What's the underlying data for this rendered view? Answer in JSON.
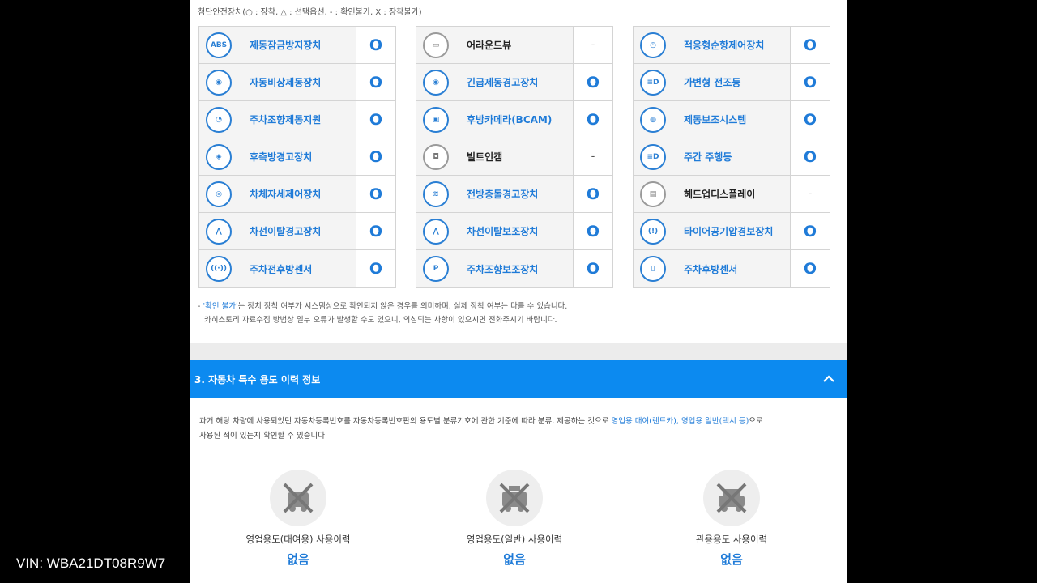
{
  "legend": "첨단안전장치(○ : 장착, △ : 선택옵션, - : 확인불가, X : 장착불가)",
  "columns": [
    [
      {
        "icon": "abs-icon",
        "icon_text": "ABS",
        "label": "제동잠금방지장치",
        "value": "O",
        "on": true
      },
      {
        "icon": "emergency-brake-icon",
        "icon_text": "◉",
        "label": "자동비상제동장치",
        "value": "O",
        "on": true
      },
      {
        "icon": "parking-steer-icon",
        "icon_text": "◔",
        "label": "주차조향제동지원",
        "value": "O",
        "on": true
      },
      {
        "icon": "rear-side-warning-icon",
        "icon_text": "◈",
        "label": "후측방경고장치",
        "value": "O",
        "on": true
      },
      {
        "icon": "stability-control-icon",
        "icon_text": "◎",
        "label": "차체자세제어장치",
        "value": "O",
        "on": true
      },
      {
        "icon": "lane-departure-icon",
        "icon_text": "⋀",
        "label": "차선이탈경고장치",
        "value": "O",
        "on": true
      },
      {
        "icon": "parking-sensor-icon",
        "icon_text": "((·))",
        "label": "주차전후방센서",
        "value": "O",
        "on": true
      }
    ],
    [
      {
        "icon": "around-view-icon",
        "icon_text": "▭",
        "label": "어라운드뷰",
        "value": "-",
        "on": false
      },
      {
        "icon": "emergency-warning-icon",
        "icon_text": "◉",
        "label": "긴급제동경고장치",
        "value": "O",
        "on": true
      },
      {
        "icon": "rear-camera-icon",
        "icon_text": "▣",
        "label": "후방카메라(BCAM)",
        "value": "O",
        "on": true
      },
      {
        "icon": "builtin-cam-icon",
        "icon_text": "◘",
        "label": "빌트인캠",
        "value": "-",
        "on": false
      },
      {
        "icon": "forward-collision-icon",
        "icon_text": "≋",
        "label": "전방충돌경고장치",
        "value": "O",
        "on": true
      },
      {
        "icon": "lane-keep-icon",
        "icon_text": "⋀",
        "label": "차선이탈보조장치",
        "value": "O",
        "on": true
      },
      {
        "icon": "parking-assist-icon",
        "icon_text": "P",
        "label": "주차조향보조장치",
        "value": "O",
        "on": true
      }
    ],
    [
      {
        "icon": "adaptive-cruise-icon",
        "icon_text": "◷",
        "label": "적응형순항제어장치",
        "value": "O",
        "on": true
      },
      {
        "icon": "adaptive-headlight-icon",
        "icon_text": "≡D",
        "label": "가변형 전조등",
        "value": "O",
        "on": true
      },
      {
        "icon": "brake-assist-icon",
        "icon_text": "◍",
        "label": "제동보조시스템",
        "value": "O",
        "on": true
      },
      {
        "icon": "daytime-light-icon",
        "icon_text": "≡D",
        "label": "주간 주행등",
        "value": "O",
        "on": true
      },
      {
        "icon": "hud-icon",
        "icon_text": "▤",
        "label": "헤드업디스플레이",
        "value": "-",
        "on": false
      },
      {
        "icon": "tire-pressure-icon",
        "icon_text": "(!)",
        "label": "타이어공기압경보장치",
        "value": "O",
        "on": true
      },
      {
        "icon": "rear-sensor-icon",
        "icon_text": "▯",
        "label": "주차후방센서",
        "value": "O",
        "on": true
      }
    ]
  ],
  "note": {
    "line1_prefix": "- ",
    "line1_highlight": "'확인 불가'",
    "line1_rest": "는 장치 장착 여부가 시스템상으로 확인되지 않은 경우를 의미하며, 실제 장착 여부는 다를 수 있습니다.",
    "line2": "카히스토리 자료수집 방법상 일부 오류가 발생할 수도 있으니, 의심되는 사항이 있으시면 전화주시기 바랍니다."
  },
  "section": {
    "title": "3. 자동차 특수 용도 이력 정보",
    "desc_part1": "과거 해당 차량에 사용되었던 자동차등록번호를 자동차등록번호판의 용도별 분류기호에 관한 기준에 따라 분류, 제공하는 것으로 ",
    "desc_highlight": "영업용 대여(렌트카), 영업용 일반(택시 등)",
    "desc_part2": "으로",
    "desc_line2": "사용된 적이 있는지 확인할 수 있습니다."
  },
  "usage": [
    {
      "label": "영업용도(대여용) 사용이력",
      "value": "없음",
      "icon": "rental-car-crossed-icon"
    },
    {
      "label": "영업용도(일반) 사용이력",
      "value": "없음",
      "icon": "taxi-crossed-icon"
    },
    {
      "label": "관용용도 사용이력",
      "value": "없음",
      "icon": "official-car-crossed-icon"
    }
  ],
  "vin": "VIN: WBA21DT08R9W7"
}
